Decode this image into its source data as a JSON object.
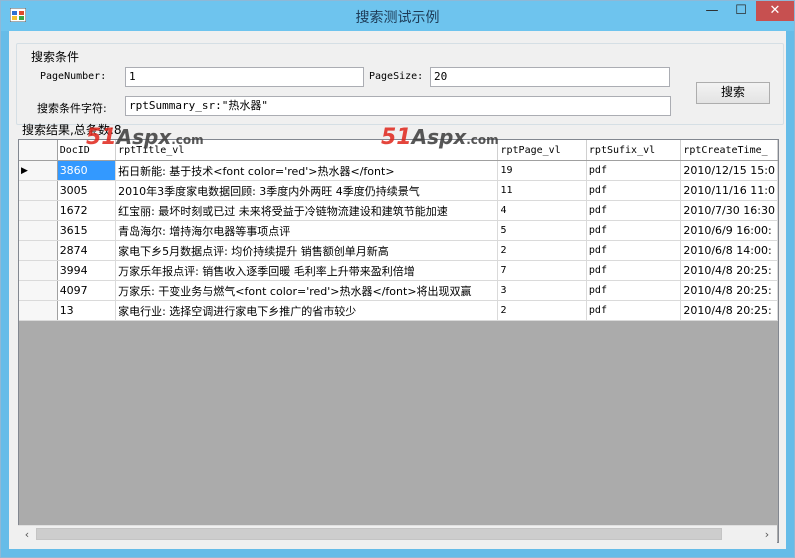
{
  "window": {
    "title": "搜索测试示例",
    "min_glyph": "—",
    "max_glyph": "☐",
    "close_glyph": "✕"
  },
  "group": {
    "title": "搜索条件",
    "page_number_label": "PageNumber:",
    "page_number_value": "1",
    "page_size_label": "PageSize:",
    "page_size_value": "20",
    "query_label": "搜索条件字符:",
    "query_value": "rptSummary_sr:\"热水器\"",
    "search_button": "搜索"
  },
  "result_label": "搜索结果,总条数:8",
  "watermark": {
    "brand": "51",
    "mid": "Aspx",
    "suffix": ".com"
  },
  "grid": {
    "columns": [
      "DocID",
      "rptTitle_vl",
      "rptPage_vl",
      "rptSufix_vl",
      "rptCreateTime_"
    ],
    "current_row_glyph": "▶",
    "rows": [
      [
        "3860",
        "拓日新能: 基于技术<font color='red'>热水器</font>",
        "19",
        "pdf",
        "2010/12/15 15:0"
      ],
      [
        "3005",
        "2010年3季度家电数据回顾: 3季度内外两旺 4季度仍持续景气",
        "11",
        "pdf",
        "2010/11/16 11:0"
      ],
      [
        "1672",
        "红宝丽: 最坏时刻或已过 未来将受益于冷链物流建设和建筑节能加速",
        "4",
        "pdf",
        "2010/7/30 16:30"
      ],
      [
        "3615",
        "青岛海尔: 增持海尔电器等事项点评",
        "5",
        "pdf",
        "2010/6/9 16:00:"
      ],
      [
        "2874",
        "家电下乡5月数据点评: 均价持续提升 销售额创单月新高",
        "2",
        "pdf",
        "2010/6/8 14:00:"
      ],
      [
        "3994",
        "万家乐年报点评: 销售收入逐季回暖 毛利率上升带来盈利倍增",
        "7",
        "pdf",
        "2010/4/8 20:25:"
      ],
      [
        "4097",
        "万家乐: 干变业务与燃气<font color='red'>热水器</font>将出现双赢",
        "3",
        "pdf",
        "2010/4/8 20:25:"
      ],
      [
        "13",
        "家电行业: 选择空调进行家电下乡推广的省市较少",
        "2",
        "pdf",
        "2010/4/8 20:25:"
      ]
    ]
  },
  "scrollbar": {
    "left_arrow": "‹",
    "right_arrow": "›"
  },
  "colors": {
    "titlebar": "#6ec4ee",
    "selection": "#3399ff",
    "close": "#c75050"
  }
}
